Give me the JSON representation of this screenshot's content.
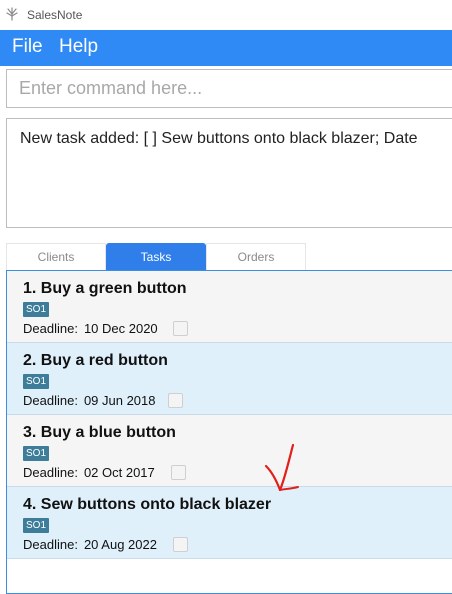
{
  "window": {
    "title": "SalesNote"
  },
  "menu": {
    "file": "File",
    "help": "Help"
  },
  "command": {
    "placeholder": "Enter command here...",
    "value": ""
  },
  "result": {
    "text": "New task added: [ ] Sew buttons onto black blazer; Date"
  },
  "tabs": [
    {
      "label": "Clients",
      "active": false
    },
    {
      "label": "Tasks",
      "active": true
    },
    {
      "label": "Orders",
      "active": false
    }
  ],
  "tasks": [
    {
      "title": "1.  Buy a green button",
      "tag": "SO1",
      "deadline_label": "Deadline:",
      "deadline": "10 Dec 2020",
      "done": false
    },
    {
      "title": "2.  Buy a red button",
      "tag": "SO1",
      "deadline_label": "Deadline:",
      "deadline": "09 Jun 2018",
      "done": false
    },
    {
      "title": "3.  Buy a blue button",
      "tag": "SO1",
      "deadline_label": "Deadline:",
      "deadline": "02 Oct 2017",
      "done": false
    },
    {
      "title": "4.  Sew buttons onto black blazer",
      "tag": "SO1",
      "deadline_label": "Deadline:",
      "deadline": "20 Aug 2022",
      "done": false
    }
  ],
  "colors": {
    "menubar": "#2f8af5",
    "active_tab": "#2f7ee9",
    "tag": "#3d7d9a",
    "annotation": "#e0201b"
  },
  "icons": {
    "app": "flower-icon",
    "annotation": "red-check-arrow-icon"
  }
}
